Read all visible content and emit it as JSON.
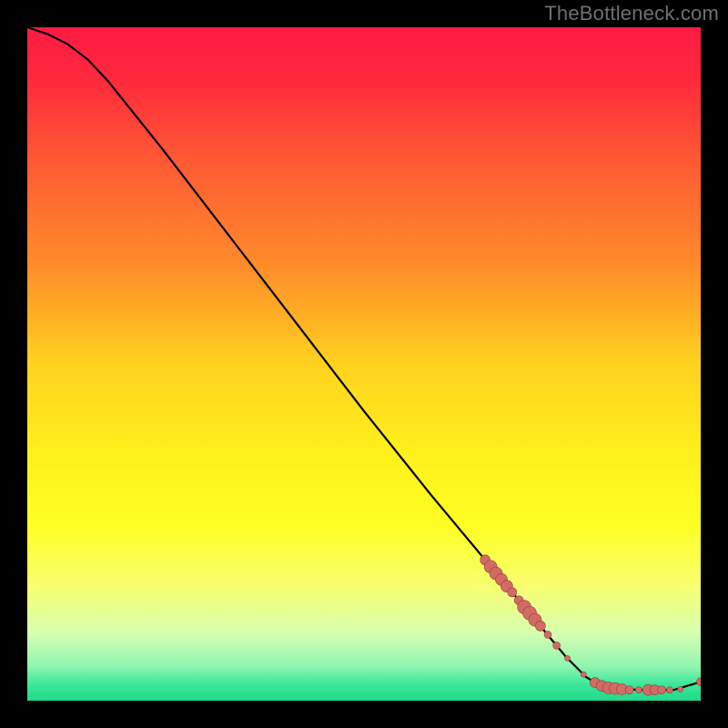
{
  "watermark_text": "TheBottleneck.com",
  "chart_data": {
    "type": "line",
    "title": "",
    "xlabel": "",
    "ylabel": "",
    "xlim": [
      0,
      100
    ],
    "ylim": [
      0,
      100
    ],
    "background": {
      "type": "vertical-gradient",
      "stops": [
        {
          "offset": 0.0,
          "color": "#ff1a44"
        },
        {
          "offset": 0.08,
          "color": "#ff2a3c"
        },
        {
          "offset": 0.2,
          "color": "#ff5a33"
        },
        {
          "offset": 0.35,
          "color": "#ff8a2a"
        },
        {
          "offset": 0.5,
          "color": "#ffd21f"
        },
        {
          "offset": 0.62,
          "color": "#ffee1a"
        },
        {
          "offset": 0.74,
          "color": "#ffff22"
        },
        {
          "offset": 0.83,
          "color": "#f8ff70"
        },
        {
          "offset": 0.9,
          "color": "#d7ffb0"
        },
        {
          "offset": 0.95,
          "color": "#8cf5b0"
        },
        {
          "offset": 0.975,
          "color": "#3de89a"
        },
        {
          "offset": 1.0,
          "color": "#1fd98a"
        }
      ]
    },
    "series": [
      {
        "name": "bottleneck-curve",
        "kind": "line",
        "color": "#000000",
        "points": [
          {
            "x": 0.0,
            "y": 100.0
          },
          {
            "x": 3.0,
            "y": 99.0
          },
          {
            "x": 6.0,
            "y": 97.5
          },
          {
            "x": 9.0,
            "y": 95.2
          },
          {
            "x": 12.0,
            "y": 92.0
          },
          {
            "x": 20.0,
            "y": 82.0
          },
          {
            "x": 30.0,
            "y": 69.0
          },
          {
            "x": 40.0,
            "y": 56.0
          },
          {
            "x": 50.0,
            "y": 43.0
          },
          {
            "x": 60.0,
            "y": 30.5
          },
          {
            "x": 68.0,
            "y": 20.9
          },
          {
            "x": 70.0,
            "y": 18.5
          },
          {
            "x": 75.0,
            "y": 12.5
          },
          {
            "x": 78.0,
            "y": 8.9
          },
          {
            "x": 80.0,
            "y": 6.5
          },
          {
            "x": 83.0,
            "y": 3.5
          },
          {
            "x": 85.0,
            "y": 2.3
          },
          {
            "x": 88.0,
            "y": 1.7
          },
          {
            "x": 92.0,
            "y": 1.6
          },
          {
            "x": 96.0,
            "y": 1.6
          },
          {
            "x": 100.0,
            "y": 2.8
          }
        ]
      },
      {
        "name": "highlight-points",
        "kind": "scatter",
        "color": "#d36b65",
        "points": [
          {
            "x": 68.0,
            "y": 20.9,
            "r": 5.5
          },
          {
            "x": 68.8,
            "y": 19.9,
            "r": 7.0
          },
          {
            "x": 69.6,
            "y": 18.9,
            "r": 7.0
          },
          {
            "x": 70.4,
            "y": 18.0,
            "r": 6.5
          },
          {
            "x": 71.2,
            "y": 17.0,
            "r": 6.5
          },
          {
            "x": 72.0,
            "y": 16.1,
            "r": 5.0
          },
          {
            "x": 73.0,
            "y": 14.9,
            "r": 5.0
          },
          {
            "x": 73.8,
            "y": 13.9,
            "r": 7.5
          },
          {
            "x": 74.6,
            "y": 13.0,
            "r": 7.5
          },
          {
            "x": 75.4,
            "y": 12.0,
            "r": 7.0
          },
          {
            "x": 76.2,
            "y": 11.1,
            "r": 5.5
          },
          {
            "x": 77.3,
            "y": 9.8,
            "r": 4.0
          },
          {
            "x": 78.6,
            "y": 8.2,
            "r": 4.0
          },
          {
            "x": 80.2,
            "y": 6.3,
            "r": 3.0
          },
          {
            "x": 82.6,
            "y": 3.9,
            "r": 3.0
          },
          {
            "x": 84.3,
            "y": 2.7,
            "r": 5.5
          },
          {
            "x": 85.3,
            "y": 2.2,
            "r": 6.0
          },
          {
            "x": 86.3,
            "y": 1.9,
            "r": 6.5
          },
          {
            "x": 87.3,
            "y": 1.8,
            "r": 6.5
          },
          {
            "x": 88.3,
            "y": 1.7,
            "r": 6.0
          },
          {
            "x": 89.4,
            "y": 1.6,
            "r": 4.5
          },
          {
            "x": 90.8,
            "y": 1.6,
            "r": 3.5
          },
          {
            "x": 92.2,
            "y": 1.6,
            "r": 6.0
          },
          {
            "x": 93.2,
            "y": 1.6,
            "r": 5.5
          },
          {
            "x": 94.2,
            "y": 1.6,
            "r": 4.5
          },
          {
            "x": 95.4,
            "y": 1.6,
            "r": 3.5
          },
          {
            "x": 97.0,
            "y": 1.7,
            "r": 3.0
          },
          {
            "x": 100.0,
            "y": 2.8,
            "r": 4.5
          }
        ]
      }
    ]
  }
}
